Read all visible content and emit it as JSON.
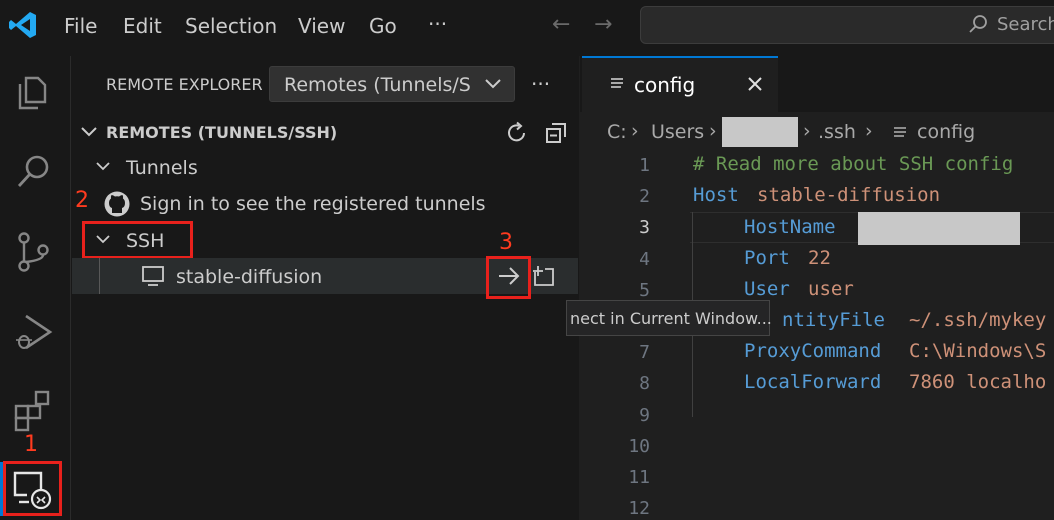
{
  "menu": {
    "file": "File",
    "edit": "Edit",
    "selection": "Selection",
    "view": "View",
    "go": "Go",
    "more": "···"
  },
  "search": {
    "label": "Search"
  },
  "sidebar": {
    "title": "REMOTE EXPLORER",
    "dropdown": "Remotes (Tunnels/S",
    "more": "···",
    "section": "REMOTES (TUNNELS/SSH)",
    "tunnels": "Tunnels",
    "sign_in": "Sign in to see the registered tunnels",
    "ssh": "SSH",
    "host": "stable-diffusion",
    "tooltip": "nect in Current Window..."
  },
  "annotations": {
    "one": "1",
    "two": "2",
    "three": "3"
  },
  "editor": {
    "tab": "config",
    "breadcrumb": {
      "drive": "C:",
      "users": "Users",
      ".ssh": ".ssh",
      "file": "config"
    },
    "lines": [
      "1",
      "2",
      "3",
      "4",
      "5",
      "7",
      "8",
      "9",
      "10",
      "11",
      "12"
    ],
    "code": {
      "l1": "# Read more about SSH config",
      "l2_kw": "Host",
      "l2_val": "stable-diffusion",
      "l3_kw": "HostName",
      "l4_kw": "Port",
      "l4_val": "22",
      "l5_kw": "User",
      "l5_val": "user",
      "l6_kw": "ntityFile",
      "l6_val": "~/.ssh/mykey",
      "l7_kw": "ProxyCommand",
      "l7_val": "C:\\Windows\\S",
      "l8_kw": "LocalForward",
      "l8_val": "7860 localho"
    }
  },
  "colors": {
    "accent": "#0078d4",
    "annotation": "#e8211c",
    "keyword": "#569cd6",
    "value": "#ce9178",
    "comment": "#6a9955"
  }
}
